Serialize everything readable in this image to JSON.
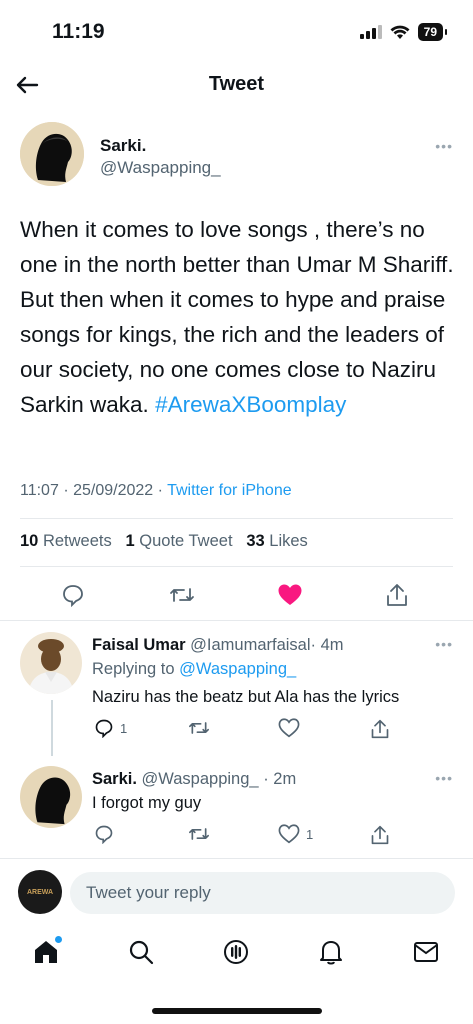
{
  "status_bar": {
    "time": "11:19",
    "battery": "79"
  },
  "header": {
    "title": "Tweet"
  },
  "tweet": {
    "author_name": "Sarki.",
    "author_handle": "@Waspapping_",
    "text": "When it comes to love songs , there’s no one in the north better than Umar M Shariff. But then when it comes to hype and praise songs for kings, the rich and the leaders of our society, no one comes close to Naziru Sarkin waka.",
    "hashtag": "#ArewaXBoomplay",
    "time": "11:07",
    "date": "25/09/2022",
    "source": "Twitter for iPhone",
    "stats": {
      "retweets": "10",
      "retweets_label": "Retweets",
      "quotes": "1",
      "quotes_label": "Quote Tweet",
      "likes": "33",
      "likes_label": "Likes"
    },
    "liked_color": "#f91880"
  },
  "replies": [
    {
      "name": "Faisal Umar",
      "handle": "@Iamumarfaisal",
      "age": "· 4m",
      "replying_prefix": "Replying to",
      "replying_to": "@Waspapping_",
      "text": "Naziru has the beatz but Ala has the lyrics",
      "reply_count": "1",
      "like_count": ""
    },
    {
      "name": "Sarki.",
      "handle": "@Waspapping_",
      "age": "· 2m",
      "text": "I forgot my guy",
      "reply_count": "",
      "like_count": "1"
    }
  ],
  "reply_bar": {
    "placeholder": "Tweet your reply",
    "avatar_text": "AREWA"
  },
  "tabs": [
    "home-icon",
    "search-icon",
    "spaces-icon",
    "notifications-icon",
    "messages-icon"
  ],
  "accent": "#1d9bf0"
}
